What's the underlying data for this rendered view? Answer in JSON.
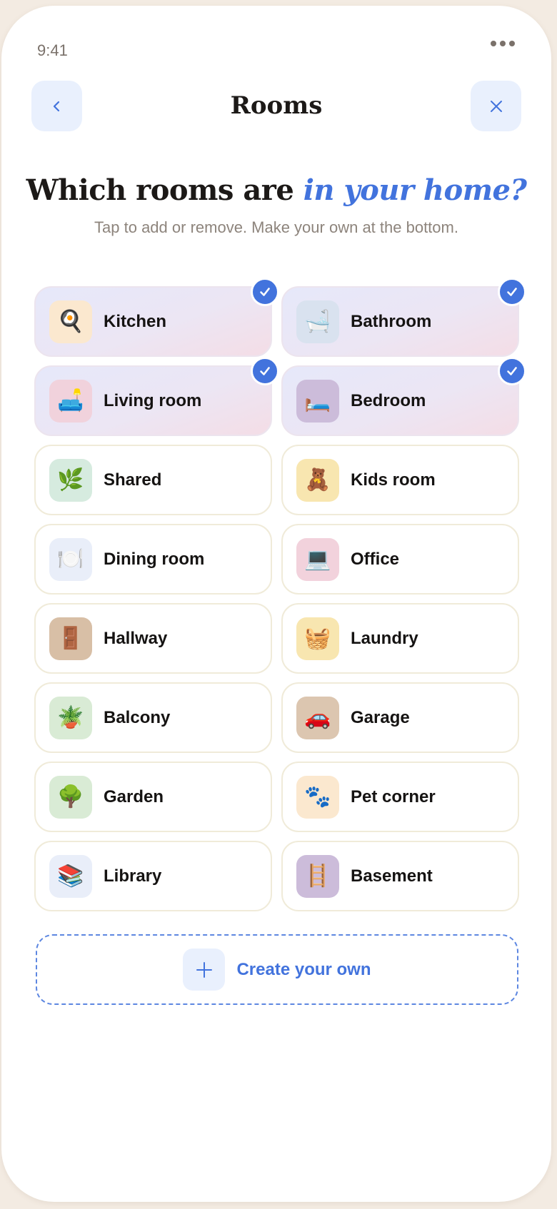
{
  "status_bar": {
    "time": "9:41"
  },
  "header": {
    "title": "Rooms"
  },
  "hero": {
    "headline_plain": "Which rooms are ",
    "headline_accent": "in your home?",
    "subtitle": "Tap to add or remove. Make your own at the bottom."
  },
  "rooms": [
    {
      "label": "Kitchen",
      "emoji": "🍳",
      "icon_name": "frying-pan-icon",
      "tile_color": "#fbe8cf",
      "selected": true
    },
    {
      "label": "Bathroom",
      "emoji": "🛁",
      "icon_name": "bathtub-icon",
      "tile_color": "#d9e2ef",
      "selected": true
    },
    {
      "label": "Living room",
      "emoji": "🛋️",
      "icon_name": "couch-icon",
      "tile_color": "#f1d2dc",
      "selected": true
    },
    {
      "label": "Bedroom",
      "emoji": "🛏️",
      "icon_name": "bed-icon",
      "tile_color": "#ccbcda",
      "selected": true
    },
    {
      "label": "Shared",
      "emoji": "🌿",
      "icon_name": "herb-icon",
      "tile_color": "#d6ebdf",
      "selected": false
    },
    {
      "label": "Kids room",
      "emoji": "🧸",
      "icon_name": "teddy-bear-icon",
      "tile_color": "#f8e6b0",
      "selected": false
    },
    {
      "label": "Dining room",
      "emoji": "🍽️",
      "icon_name": "plate-cutlery-icon",
      "tile_color": "#e9eef9",
      "selected": false
    },
    {
      "label": "Office",
      "emoji": "💻",
      "icon_name": "laptop-icon",
      "tile_color": "#f2d2dc",
      "selected": false
    },
    {
      "label": "Hallway",
      "emoji": "🚪",
      "icon_name": "door-icon",
      "tile_color": "#d8bfa6",
      "selected": false
    },
    {
      "label": "Laundry",
      "emoji": "🧺",
      "icon_name": "basket-icon",
      "tile_color": "#f8e6b0",
      "selected": false
    },
    {
      "label": "Balcony",
      "emoji": "🪴",
      "icon_name": "potted-plant-icon",
      "tile_color": "#d9ebd5",
      "selected": false
    },
    {
      "label": "Garage",
      "emoji": "🚗",
      "icon_name": "car-icon",
      "tile_color": "#dcc6b0",
      "selected": false
    },
    {
      "label": "Garden",
      "emoji": "🌳",
      "icon_name": "tree-icon",
      "tile_color": "#d9ebd5",
      "selected": false
    },
    {
      "label": "Pet corner",
      "emoji": "🐾",
      "icon_name": "paw-prints-icon",
      "tile_color": "#fbe8cf",
      "selected": false
    },
    {
      "label": "Library",
      "emoji": "📚",
      "icon_name": "books-icon",
      "tile_color": "#e9eef9",
      "selected": false
    },
    {
      "label": "Basement",
      "emoji": "🪜",
      "icon_name": "ladder-icon",
      "tile_color": "#ccbcda",
      "selected": false
    }
  ],
  "create": {
    "label": "Create your own"
  },
  "colors": {
    "accent": "#4273dd",
    "background": "#f3ebe2",
    "card_border": "#f0ebd9",
    "button_bg": "#e9f0fd"
  }
}
